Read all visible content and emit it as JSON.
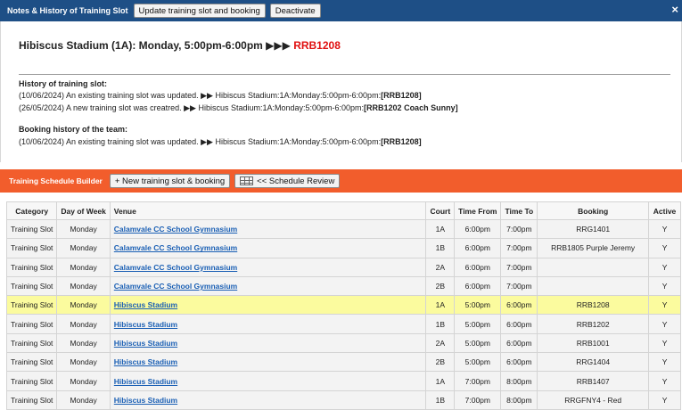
{
  "top_bar": {
    "title": "Notes & History of Training Slot",
    "update_button": "Update training slot and booking",
    "deactivate_button": "Deactivate",
    "close": "×"
  },
  "notes": {
    "heading": "Hibiscus Stadium (1A): Monday, 5:00pm-6:00pm ▶▶▶ ",
    "heading_code": "RRB1208",
    "history_title": "History of training slot:",
    "history": [
      "(10/06/2024) An existing training slot was updated. ▶▶ Hibiscus Stadium:1A:Monday:5:00pm-6:00pm:",
      "(26/05/2024) A new training slot was creatred. ▶▶ Hibiscus Stadium:1A:Monday:5:00pm-6:00pm:"
    ],
    "history_bold": [
      "[RRB1208]",
      "[RRB1202 Coach Sunny]"
    ],
    "booking_title": "Booking history of the team:",
    "booking": [
      "(10/06/2024) An existing training slot was updated. ▶▶ Hibiscus Stadium:1A:Monday:5:00pm-6:00pm:"
    ],
    "booking_bold": [
      "[RRB1208]"
    ]
  },
  "builder": {
    "title": "Training Schedule Builder",
    "new_button": "+ New training slot & booking",
    "review_button": "<< Schedule Review"
  },
  "table": {
    "headers": [
      "Category",
      "Day of Week",
      "Venue",
      "Court",
      "Time From",
      "Time To",
      "Booking",
      "Active"
    ],
    "rows": [
      [
        "Training Slot",
        "Monday",
        "Calamvale CC School Gymnasium",
        "1A",
        "6:00pm",
        "7:00pm",
        "RRG1401",
        "Y"
      ],
      [
        "Training Slot",
        "Monday",
        "Calamvale CC School Gymnasium",
        "1B",
        "6:00pm",
        "7:00pm",
        "RRB1805 Purple Jeremy",
        "Y"
      ],
      [
        "Training Slot",
        "Monday",
        "Calamvale CC School Gymnasium",
        "2A",
        "6:00pm",
        "7:00pm",
        "",
        "Y"
      ],
      [
        "Training Slot",
        "Monday",
        "Calamvale CC School Gymnasium",
        "2B",
        "6:00pm",
        "7:00pm",
        "",
        "Y"
      ],
      [
        "Training Slot",
        "Monday",
        "Hibiscus Stadium",
        "1A",
        "5:00pm",
        "6:00pm",
        "RRB1208",
        "Y"
      ],
      [
        "Training Slot",
        "Monday",
        "Hibiscus Stadium",
        "1B",
        "5:00pm",
        "6:00pm",
        "RRB1202",
        "Y"
      ],
      [
        "Training Slot",
        "Monday",
        "Hibiscus Stadium",
        "2A",
        "5:00pm",
        "6:00pm",
        "RRB1001",
        "Y"
      ],
      [
        "Training Slot",
        "Monday",
        "Hibiscus Stadium",
        "2B",
        "5:00pm",
        "6:00pm",
        "RRG1404",
        "Y"
      ],
      [
        "Training Slot",
        "Monday",
        "Hibiscus Stadium",
        "1A",
        "7:00pm",
        "8:00pm",
        "RRB1407",
        "Y"
      ],
      [
        "Training Slot",
        "Monday",
        "Hibiscus Stadium",
        "1B",
        "7:00pm",
        "8:00pm",
        "RRGFNY4 - Red",
        "Y"
      ]
    ],
    "highlighted_row": 4
  },
  "colors": {
    "top_bar": "#1e4f86",
    "builder_bar": "#f25d2c",
    "highlight": "#fbfb9e",
    "code": "#e01010"
  }
}
